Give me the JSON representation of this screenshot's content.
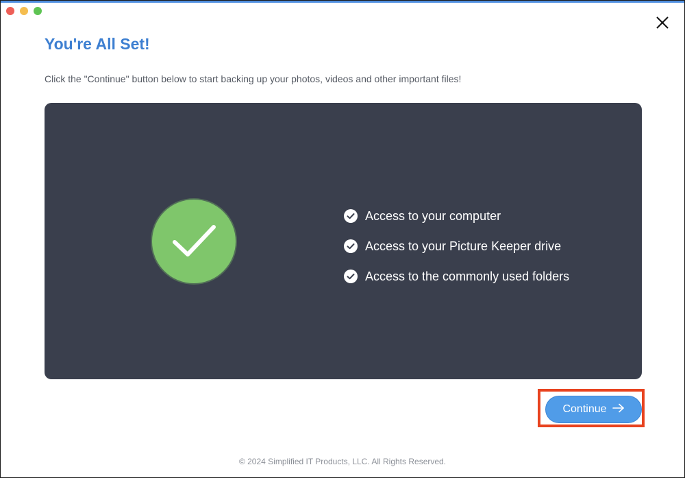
{
  "window": {
    "traffic_lights": [
      "close",
      "minimize",
      "zoom"
    ],
    "close_icon": "close-icon"
  },
  "header": {
    "title": "You're All Set!",
    "subtitle": "Click the \"Continue\" button below to start backing up your photos, videos and other important files!"
  },
  "panel": {
    "status_icon": "checkmark-circle-icon",
    "items": [
      {
        "label": "Access to your computer",
        "icon": "check-circle-icon"
      },
      {
        "label": "Access to your Picture Keeper drive",
        "icon": "check-circle-icon"
      },
      {
        "label": "Access to the commonly used folders",
        "icon": "check-circle-icon"
      }
    ]
  },
  "actions": {
    "continue_label": "Continue",
    "continue_icon": "arrow-right-icon"
  },
  "footer": {
    "copyright": "© 2024 Simplified IT Products, LLC. All Rights Reserved."
  },
  "colors": {
    "accent": "#3d7fd1",
    "button": "#509ce8",
    "panel": "#3a3f4d",
    "success": "#7fc66b",
    "highlight": "#e8431f"
  }
}
